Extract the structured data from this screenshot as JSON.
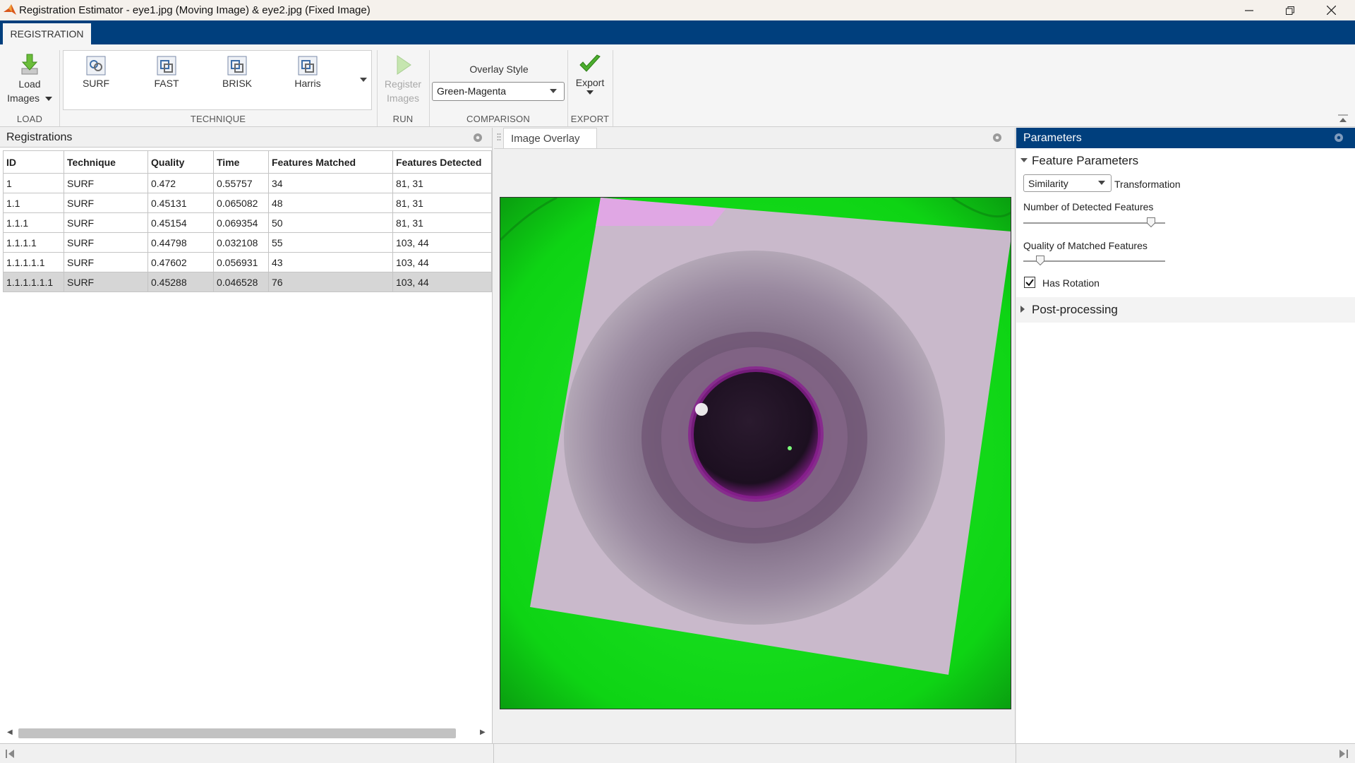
{
  "window": {
    "title": "Registration Estimator - eye1.jpg (Moving Image) & eye2.jpg (Fixed Image)",
    "controls": [
      "minimize-icon",
      "restore-icon",
      "close-icon"
    ]
  },
  "ribbon": {
    "tab": "REGISTRATION",
    "load": {
      "label_line1": "Load",
      "label_line2": "Images",
      "group": "LOAD"
    },
    "technique": {
      "group": "TECHNIQUE",
      "items": [
        {
          "label": "SURF",
          "icon": "surf-icon"
        },
        {
          "label": "FAST",
          "icon": "fast-icon"
        },
        {
          "label": "BRISK",
          "icon": "brisk-icon"
        },
        {
          "label": "Harris",
          "icon": "harris-icon"
        }
      ]
    },
    "run": {
      "label_line1": "Register",
      "label_line2": "Images",
      "group": "RUN"
    },
    "comparison": {
      "heading": "Overlay Style",
      "value": "Green-Magenta",
      "group": "COMPARISON"
    },
    "export": {
      "label": "Export",
      "group": "EXPORT"
    }
  },
  "registrations": {
    "title": "Registrations",
    "columns": [
      "ID",
      "Technique",
      "Quality",
      "Time",
      "Features Matched",
      "Features Detected"
    ],
    "rows": [
      [
        "1",
        "SURF",
        "0.472",
        "0.55757",
        "34",
        "81, 31"
      ],
      [
        "1.1",
        "SURF",
        "0.45131",
        "0.065082",
        "48",
        "81, 31"
      ],
      [
        "1.1.1",
        "SURF",
        "0.45154",
        "0.069354",
        "50",
        "81, 31"
      ],
      [
        "1.1.1.1",
        "SURF",
        "0.44798",
        "0.032108",
        "55",
        "103, 44"
      ],
      [
        "1.1.1.1.1",
        "SURF",
        "0.47602",
        "0.056931",
        "43",
        "103, 44"
      ],
      [
        "1.1.1.1.1.1",
        "SURF",
        "0.45288",
        "0.046528",
        "76",
        "103, 44"
      ]
    ],
    "selected_row": 5
  },
  "overlay": {
    "tab": "Image Overlay"
  },
  "parameters": {
    "title": "Parameters",
    "feature_section": "Feature Parameters",
    "transformation_value": "Similarity",
    "transformation_label": "Transformation",
    "detected_label": "Number of Detected Features",
    "detected_level": 0.9,
    "matched_label": "Quality of Matched Features",
    "matched_level": 0.12,
    "rotation_label": "Has Rotation",
    "rotation_checked": true,
    "post_section": "Post-processing"
  },
  "colors": {
    "accent": "#003f7d",
    "overlay_green": "#10e010",
    "overlay_magenta": "#b58ab8"
  }
}
